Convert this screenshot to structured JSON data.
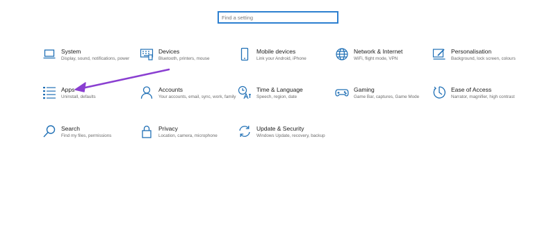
{
  "search": {
    "placeholder": "Find a setting"
  },
  "tiles": [
    {
      "title": "System",
      "desc": "Display, sound, notifications, power",
      "icon": "laptop-icon"
    },
    {
      "title": "Devices",
      "desc": "Bluetooth, printers, mouse",
      "icon": "keyboard-icon"
    },
    {
      "title": "Mobile devices",
      "desc": "Link your Android, iPhone",
      "icon": "phone-icon"
    },
    {
      "title": "Network & Internet",
      "desc": "WiFi, flight mode, VPN",
      "icon": "globe-icon"
    },
    {
      "title": "Personalisation",
      "desc": "Background, lock screen, colours",
      "icon": "paint-icon"
    },
    {
      "title": "Apps",
      "desc": "Uninstall, defaults",
      "icon": "apps-list-icon"
    },
    {
      "title": "Accounts",
      "desc": "Your accounts, email, sync, work, family",
      "icon": "person-icon"
    },
    {
      "title": "Time & Language",
      "desc": "Speech, region, date",
      "icon": "time-language-icon"
    },
    {
      "title": "Gaming",
      "desc": "Game Bar, captures, Game Mode",
      "icon": "gamepad-icon"
    },
    {
      "title": "Ease of Access",
      "desc": "Narrator, magnifier, high contrast",
      "icon": "ease-of-access-icon"
    },
    {
      "title": "Search",
      "desc": "Find my files, permissions",
      "icon": "search-icon"
    },
    {
      "title": "Privacy",
      "desc": "Location, camera, microphone",
      "icon": "lock-icon"
    },
    {
      "title": "Update & Security",
      "desc": "Windows Update, recovery, backup",
      "icon": "refresh-icon"
    }
  ],
  "colors": {
    "accent": "#2c7fd0",
    "icon": "#1f6fb5",
    "annotation_arrow": "#8a3fd1"
  }
}
